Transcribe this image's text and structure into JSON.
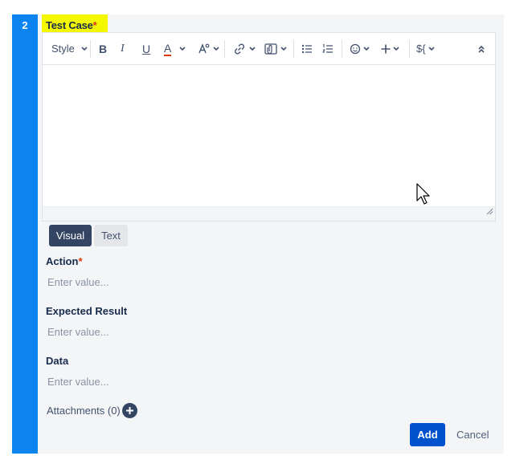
{
  "step": {
    "number": "2"
  },
  "test_case": {
    "label": "Test Case",
    "required_marker": "*",
    "toolbar": {
      "style_label": "Style",
      "bold_label": "B",
      "italic_label": "I",
      "underline_label": "U",
      "text_color_label": "A",
      "variable_label": "${"
    },
    "editor_value": ""
  },
  "editor_tabs": [
    {
      "label": "Visual",
      "selected": true
    },
    {
      "label": "Text",
      "selected": false
    }
  ],
  "fields": {
    "action": {
      "label": "Action",
      "required_marker": "*",
      "placeholder": "Enter value...",
      "value": ""
    },
    "expected_result": {
      "label": "Expected Result",
      "placeholder": "Enter value...",
      "value": ""
    },
    "data": {
      "label": "Data",
      "placeholder": "Enter value...",
      "value": ""
    }
  },
  "attachments": {
    "label": "Attachments (0)"
  },
  "actions": {
    "add_label": "Add",
    "cancel_label": "Cancel"
  },
  "colors": {
    "step_bar": "#0b84f0",
    "title_highlight": "#f3f700",
    "primary_button": "#0052cc",
    "selected_tab": "#344563",
    "required": "#de350b"
  }
}
